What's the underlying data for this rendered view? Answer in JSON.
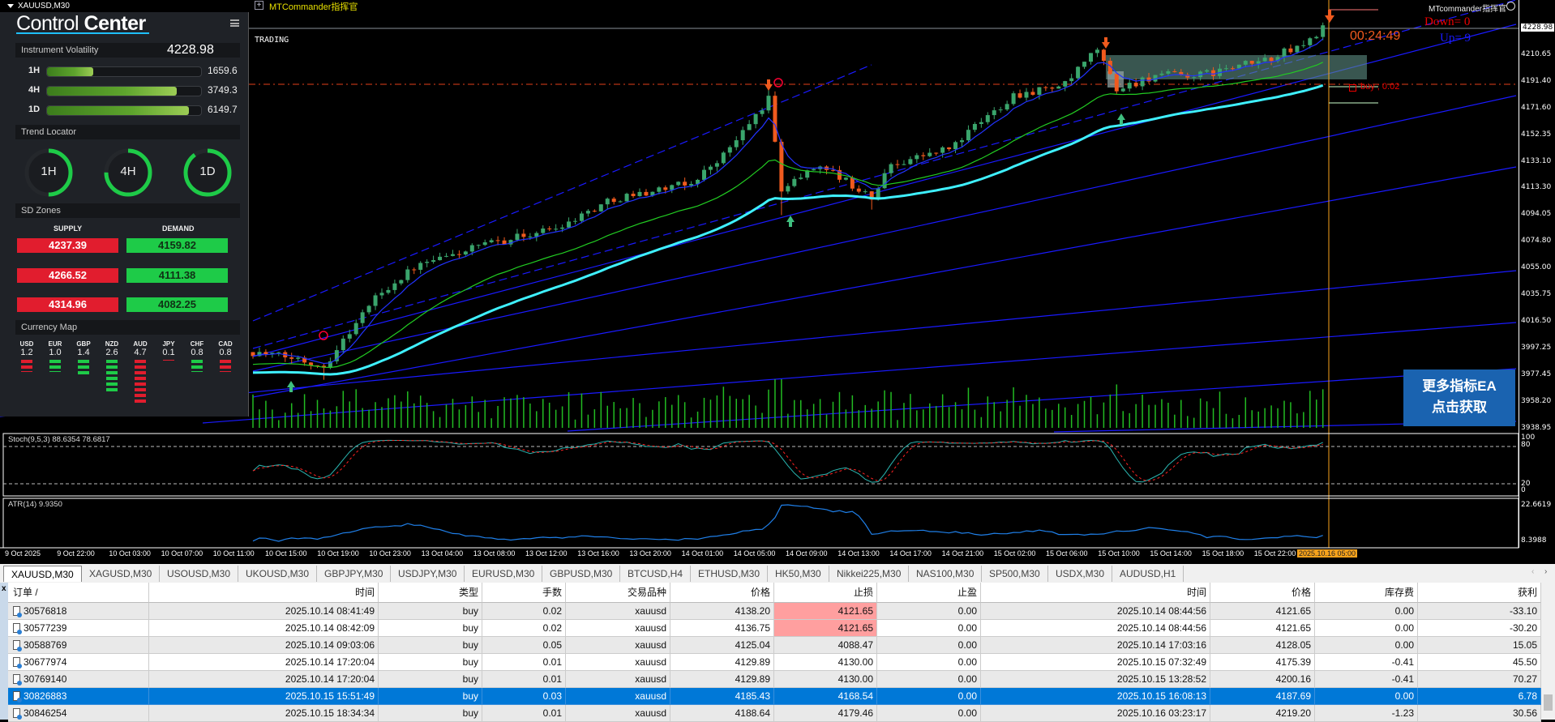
{
  "window": {
    "symbol_title": "XAUUSD,M30",
    "indicator_name": "MTCommander指挥官",
    "mode_label": "TRADING",
    "top_right_label": "MTcommander指挥官",
    "down_label": "Down= 0",
    "up_label": "Up= 9",
    "countdown": "00:24:49",
    "order_label": "buy ; 0.02",
    "banner_line1": "更多指标EA",
    "banner_line2": "点击获取"
  },
  "panel": {
    "title_light": "Control",
    "title_bold": "Center",
    "volatility": {
      "label": "Instrument Volatility",
      "value": "4228.98",
      "bars": [
        {
          "tf": "1H",
          "value": "1659.6",
          "fill": 0.3
        },
        {
          "tf": "4H",
          "value": "3749.3",
          "fill": 0.84
        },
        {
          "tf": "1D",
          "value": "6149.7",
          "fill": 0.92
        }
      ]
    },
    "trend": {
      "label": "Trend Locator",
      "items": [
        {
          "tf": "1H",
          "fill": 0.5
        },
        {
          "tf": "4H",
          "fill": 0.75
        },
        {
          "tf": "1D",
          "fill": 0.9
        }
      ]
    },
    "sd": {
      "label": "SD Zones",
      "supply_label": "SUPPLY",
      "demand_label": "DEMAND",
      "supply": [
        "4237.39",
        "4266.52",
        "4314.96"
      ],
      "demand": [
        "4159.82",
        "4111.38",
        "4082.25"
      ]
    },
    "currency": {
      "label": "Currency Map",
      "items": [
        {
          "code": "USD",
          "value": "1.2",
          "bars": 2,
          "color": "#e11d2e"
        },
        {
          "code": "EUR",
          "value": "1.0",
          "bars": 2,
          "color": "#1ecb48"
        },
        {
          "code": "GBP",
          "value": "1.4",
          "bars": 3,
          "color": "#1ecb48"
        },
        {
          "code": "NZD",
          "value": "2.6",
          "bars": 6,
          "color": "#1ecb48"
        },
        {
          "code": "AUD",
          "value": "4.7",
          "bars": 8,
          "color": "#e11d2e"
        },
        {
          "code": "JPY",
          "value": "0.1",
          "bars": 0,
          "color": "#e11d2e"
        },
        {
          "code": "CHF",
          "value": "0.8",
          "bars": 2,
          "color": "#1ecb48"
        },
        {
          "code": "CAD",
          "value": "0.8",
          "bars": 2,
          "color": "#e11d2e"
        }
      ]
    }
  },
  "chart_data": {
    "type": "candlestick",
    "symbol": "XAUUSD",
    "timeframe": "M30",
    "price_ticks": [
      "4228.98",
      "4210.65",
      "4191.40",
      "4171.60",
      "4152.35",
      "4133.10",
      "4113.30",
      "4094.05",
      "4074.80",
      "4055.00",
      "4035.75",
      "4016.50",
      "3997.25",
      "3977.45",
      "3958.20",
      "3938.95"
    ],
    "price_range": [
      3938.95,
      4228.98
    ],
    "current_price": 4228.98,
    "time_ticks": [
      "9 Oct 2025",
      "9 Oct 22:00",
      "10 Oct 03:00",
      "10 Oct 07:00",
      "10 Oct 11:00",
      "10 Oct 15:00",
      "10 Oct 19:00",
      "10 Oct 23:00",
      "13 Oct 04:00",
      "13 Oct 08:00",
      "13 Oct 12:00",
      "13 Oct 16:00",
      "13 Oct 20:00",
      "14 Oct 01:00",
      "14 Oct 05:00",
      "14 Oct 09:00",
      "14 Oct 13:00",
      "14 Oct 17:00",
      "14 Oct 21:00",
      "15 Oct 02:00",
      "15 Oct 06:00",
      "15 Oct 10:00",
      "15 Oct 14:00",
      "15 Oct 18:00",
      "15 Oct 22:00"
    ],
    "cursor_time": "2025.10.16 05:00",
    "close_path": [
      [
        0,
        3995
      ],
      [
        7,
        3990
      ],
      [
        11,
        3985
      ],
      [
        19,
        4035
      ],
      [
        25,
        4056
      ],
      [
        34,
        4070
      ],
      [
        47,
        4085
      ],
      [
        56,
        4106
      ],
      [
        68,
        4117
      ],
      [
        74,
        4142
      ],
      [
        80,
        4178
      ],
      [
        82,
        4113
      ],
      [
        88,
        4131
      ],
      [
        96,
        4106
      ],
      [
        99,
        4131
      ],
      [
        108,
        4142
      ],
      [
        118,
        4181
      ],
      [
        126,
        4188
      ],
      [
        131,
        4214
      ],
      [
        134,
        4185
      ],
      [
        140,
        4195
      ],
      [
        147,
        4195
      ],
      [
        157,
        4206
      ],
      [
        163,
        4217
      ],
      [
        166,
        4229
      ]
    ],
    "stoch": {
      "label": "Stoch(9,5,3) 88.6354 78.6817",
      "levels": [
        "100",
        "80",
        "20",
        "0"
      ]
    },
    "atr": {
      "label": "ATR(14) 9.9350",
      "max": "22.6619",
      "min": "8.3988"
    }
  },
  "tabs": [
    "XAUUSD,M30",
    "XAGUSD,M30",
    "USOUSD,M30",
    "UKOUSD,M30",
    "GBPJPY,M30",
    "USDJPY,M30",
    "EURUSD,M30",
    "GBPUSD,M30",
    "BTCUSD,H4",
    "ETHUSD,M30",
    "HK50,M30",
    "Nikkei225,M30",
    "NAS100,M30",
    "SP500,M30",
    "USDX,M30",
    "AUDUSD,H1"
  ],
  "table": {
    "headers": [
      "订单 /",
      "时间",
      "类型",
      "手数",
      "交易品种",
      "价格",
      "止损",
      "止盈",
      "时间",
      "价格",
      "库存费",
      "获利"
    ],
    "rows": [
      [
        "30576818",
        "2025.10.14 08:41:49",
        "buy",
        "0.02",
        "xauusd",
        "4138.20",
        "4121.65",
        "0.00",
        "2025.10.14 08:44:56",
        "4121.65",
        "0.00",
        "-33.10"
      ],
      [
        "30577239",
        "2025.10.14 08:42:09",
        "buy",
        "0.02",
        "xauusd",
        "4136.75",
        "4121.65",
        "0.00",
        "2025.10.14 08:44:56",
        "4121.65",
        "0.00",
        "-30.20"
      ],
      [
        "30588769",
        "2025.10.14 09:03:06",
        "buy",
        "0.05",
        "xauusd",
        "4125.04",
        "4088.47",
        "0.00",
        "2025.10.14 17:03:16",
        "4128.05",
        "0.00",
        "15.05"
      ],
      [
        "30677974",
        "2025.10.14 17:20:04",
        "buy",
        "0.01",
        "xauusd",
        "4129.89",
        "4130.00",
        "0.00",
        "2025.10.15 07:32:49",
        "4175.39",
        "-0.41",
        "45.50"
      ],
      [
        "30769140",
        "2025.10.14 17:20:04",
        "buy",
        "0.01",
        "xauusd",
        "4129.89",
        "4130.00",
        "0.00",
        "2025.10.15 13:28:52",
        "4200.16",
        "-0.41",
        "70.27"
      ],
      [
        "30826883",
        "2025.10.15 15:51:49",
        "buy",
        "0.03",
        "xauusd",
        "4185.43",
        "4168.54",
        "0.00",
        "2025.10.15 16:08:13",
        "4187.69",
        "0.00",
        "6.78"
      ],
      [
        "30846254",
        "2025.10.15 18:34:34",
        "buy",
        "0.01",
        "xauusd",
        "4188.64",
        "4179.46",
        "0.00",
        "2025.10.16 03:23:17",
        "4219.20",
        "-1.23",
        "30.56"
      ]
    ],
    "selected_row": 5,
    "sl_hit_rows": [
      0,
      1
    ]
  }
}
